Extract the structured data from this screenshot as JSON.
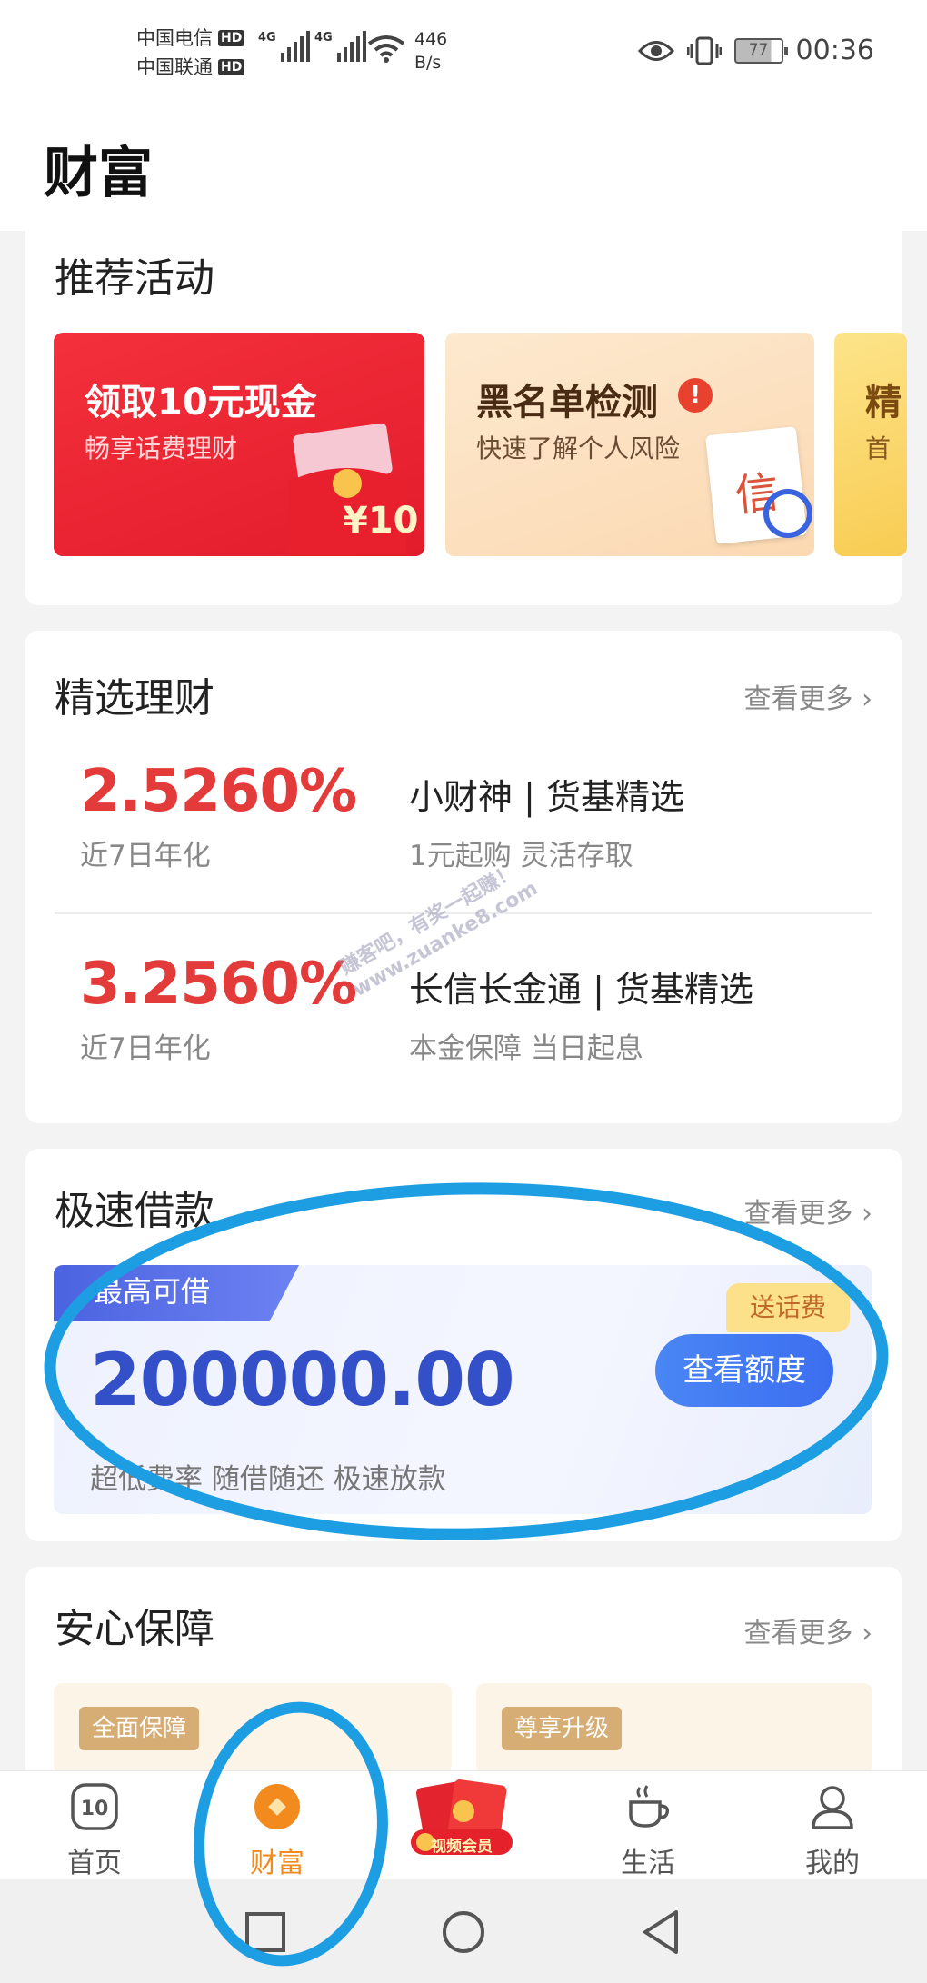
{
  "status_bar": {
    "carrier_1": "中国电信",
    "carrier_2": "中国联通",
    "hd_badge": "HD",
    "network_type": "4G",
    "net_speed_value": "446",
    "net_speed_unit": "B/s",
    "battery": "77",
    "time": "00:36"
  },
  "header": {
    "title": "财富"
  },
  "activities": {
    "title": "推荐活动",
    "cards": [
      {
        "title": "领取10元现金",
        "subtitle": "畅享话费理财",
        "badge": "¥10"
      },
      {
        "title": "黑名单检测",
        "subtitle": "快速了解个人风险",
        "badge": "信"
      },
      {
        "title": "精",
        "subtitle": "首"
      }
    ]
  },
  "finance": {
    "title": "精选理财",
    "more": "查看更多",
    "items": [
      {
        "rate": "2.5260%",
        "rate_label": "近7日年化",
        "name": "小财神 | 货基精选",
        "desc": "1元起购 灵活存取"
      },
      {
        "rate": "3.2560%",
        "rate_label": "近7日年化",
        "name": "长信长金通 | 货基精选",
        "desc": "本金保障 当日起息"
      }
    ]
  },
  "loan": {
    "title": "极速借款",
    "more": "查看更多",
    "tag": "最高可借",
    "amount": "200000.00",
    "desc": "超低费率 随借随还 极速放款",
    "cta": "查看额度",
    "gift": "送话费"
  },
  "insurance": {
    "title": "安心保障",
    "more": "查看更多",
    "tiles": [
      {
        "label": "全面保障"
      },
      {
        "label": "尊享升级"
      }
    ]
  },
  "tabbar": {
    "tabs": [
      {
        "label": "首页",
        "icon": "home-icon"
      },
      {
        "label": "财富",
        "icon": "wealth-icon",
        "active": true
      },
      {
        "label": "视频会员",
        "icon": "red-envelope-icon"
      },
      {
        "label": "生活",
        "icon": "coffee-cup-icon"
      },
      {
        "label": "我的",
        "icon": "profile-icon"
      }
    ]
  },
  "watermark": {
    "line1": "赚客吧，有奖一起赚！",
    "line2": "www.zuanke8.com"
  },
  "colors": {
    "accent_red": "#e33a3a",
    "loan_blue": "#3350c9",
    "active_tab": "#f38a1e",
    "annotation": "#1e9ee2"
  }
}
